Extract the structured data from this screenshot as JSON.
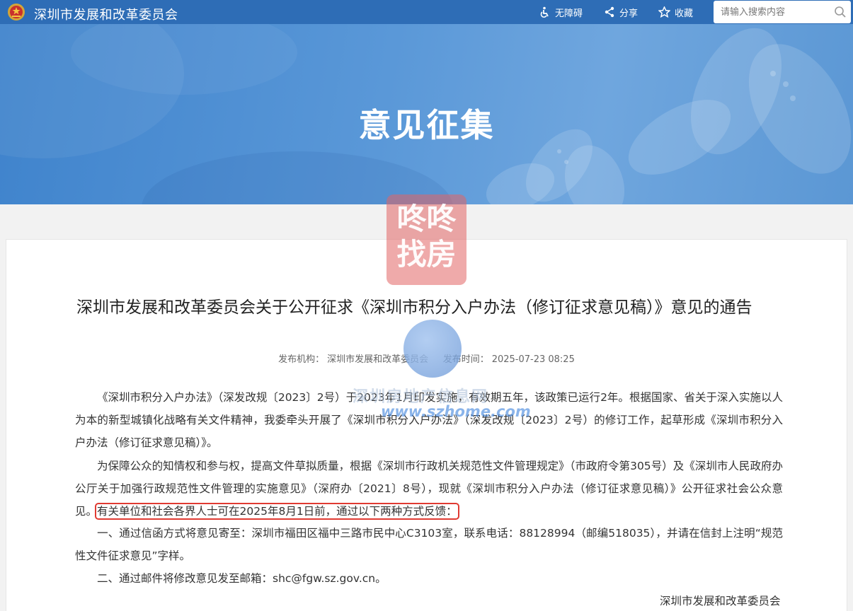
{
  "header": {
    "site_name": "深圳市发展和改革委员会",
    "accessibility_label": "无障碍",
    "share_label": "分享",
    "favorite_label": "收藏",
    "search_placeholder": "请输入搜索内容"
  },
  "banner": {
    "title": "意见征集"
  },
  "article": {
    "title": "深圳市发展和改革委员会关于公开征求《深圳市积分入户办法（修订征求意见稿）》意见的通告",
    "publisher_label": "发布机构：",
    "publisher": "深圳市发展和改革委员会",
    "publish_time_label": "发布时间：",
    "publish_time": "2025-07-23 08:25",
    "paragraphs": {
      "p1": "《深圳市积分入户办法》（深发改规〔2023〕2号）于2023年1月印发实施，有效期五年，该政策已运行2年。根据国家、省关于深入实施以人为本的新型城镇化战略有关文件精神，我委牵头开展了《深圳市积分入户办法》（深发改规〔2023〕2号）的修订工作，起草形成《深圳市积分入户办法（修订征求意见稿）》。",
      "p2_a": "为保障公众的知情权和参与权，提高文件草拟质量，根据《深圳市行政机关规范性文件管理规定》（市政府令第305号）及《深圳市人民政府办公厅关于加强行政规范性文件管理的实施意见》（深府办〔2021〕8号），现就《深圳市积分入户办法（修订征求意见稿）》公开征求社会公众意见。",
      "p2_highlight": "有关单位和社会各界人士可在2025年8月1日前，通过以下两种方式反馈：",
      "p3": "一、通过信函方式将意见寄至：深圳市福田区福中三路市民中心C3103室，联系电话：88128994（邮编518035），并请在信封上注明“规范性文件征求意见”字样。",
      "p4": "二、通过邮件将修改意见发至邮箱：shc@fgw.sz.gov.cn。"
    },
    "signature": "深圳市发展和改革委员会"
  },
  "watermarks": {
    "logo_text_line1": "咚咚",
    "logo_text_line2": "找房",
    "site_cn": "深圳房地产信息网",
    "site_en": "www.szhome.com"
  },
  "colors": {
    "topbar": "#2e6db6",
    "banner": "#5a98d8",
    "highlight_border": "#e03a32"
  }
}
